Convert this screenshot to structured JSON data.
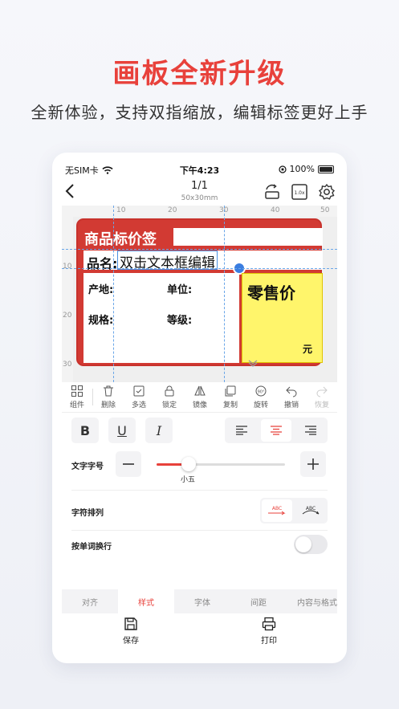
{
  "promo": {
    "title": "画板全新升级",
    "subtitle": "全新体验，支持双指缩放，编辑标签更好上手"
  },
  "status_bar": {
    "carrier": "无SIM卡",
    "time": "下午4:23",
    "battery": "100%"
  },
  "navbar": {
    "page": "1/1",
    "size": "50x30mm",
    "icons": [
      "back-icon",
      "rotate-screen-icon",
      "zoom-ratio-icon",
      "settings-gear-icon"
    ],
    "zoom_icon_text": "1.0x"
  },
  "ruler": {
    "top": [
      "10",
      "20",
      "30",
      "40",
      "50"
    ],
    "left": [
      "10",
      "20",
      "30"
    ]
  },
  "label": {
    "header": "商品标价签",
    "name_label": "品名:",
    "name_value": "双击文本框编辑",
    "origin": "产地:",
    "unit": "单位:",
    "spec": "规格:",
    "grade": "等级:",
    "price_title": "零售价",
    "price_unit": "元",
    "colors": {
      "frame": "#d23a33",
      "price_bg": "#fff56b",
      "selection": "#4a90e2"
    }
  },
  "toolbar": {
    "items": [
      {
        "label": "组件",
        "icon": "grid-components-icon",
        "enabled": true
      },
      {
        "label": "删除",
        "icon": "trash-icon",
        "enabled": true
      },
      {
        "label": "多选",
        "icon": "multi-select-icon",
        "enabled": true
      },
      {
        "label": "锁定",
        "icon": "lock-icon",
        "enabled": true
      },
      {
        "label": "镜像",
        "icon": "mirror-icon",
        "enabled": true
      },
      {
        "label": "复制",
        "icon": "copy-icon",
        "enabled": true
      },
      {
        "label": "旋转",
        "icon": "rotate-90-icon",
        "enabled": true
      },
      {
        "label": "撤销",
        "icon": "undo-icon",
        "enabled": true
      },
      {
        "label": "恢复",
        "icon": "redo-icon",
        "enabled": false
      }
    ],
    "rotate_icon_text": "90°"
  },
  "format": {
    "bold": "B",
    "underline": "U",
    "italic": "I",
    "align_selected": "center"
  },
  "font_size": {
    "label": "文字字号",
    "value": "小五",
    "level": 0.25
  },
  "char_arrange": {
    "label": "字符排列",
    "options": [
      "ABC",
      "ABC"
    ],
    "selected": 0
  },
  "word_wrap": {
    "label": "按单词换行",
    "on": false
  },
  "tabs": {
    "items": [
      "对齐",
      "样式",
      "字体",
      "间距",
      "内容与格式"
    ],
    "active": 1
  },
  "actions": {
    "save": "保存",
    "print": "打印"
  },
  "accent": "#e8413b"
}
